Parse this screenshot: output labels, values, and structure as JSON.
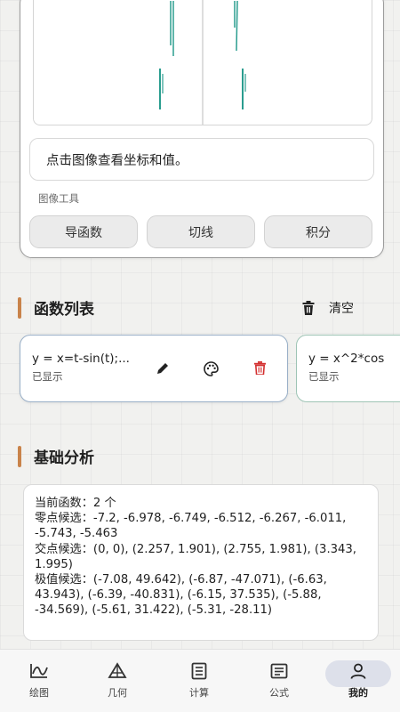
{
  "graph_card": {
    "hint": "点击图像查看坐标和值。",
    "tools_label": "图像工具",
    "tools": [
      "导函数",
      "切线",
      "积分"
    ]
  },
  "function_list": {
    "title": "函数列表",
    "clear_label": "清空",
    "items": [
      {
        "expression": "y = x=t-sin(t);...",
        "status": "已显示"
      },
      {
        "expression": "y = x^2*cos",
        "status": "已显示"
      }
    ]
  },
  "analysis": {
    "title": "基础分析",
    "lines": [
      "当前函数：2 个",
      "零点候选：-7.2, -6.978, -6.749, -6.512, -6.267, -6.011, -5.743, -5.463",
      "交点候选：(0, 0), (2.257, 1.901), (2.755, 1.981), (3.343, 1.995)",
      "极值候选：(-7.08, 49.642), (-6.87, -47.071), (-6.63, 43.943), (-6.39, -40.831), (-6.15, 37.535), (-5.88, -34.569), (-5.61, 31.422), (-5.31, -28.11)"
    ]
  },
  "bottom_nav": {
    "items": [
      {
        "label": "绘图",
        "icon": "plot-icon"
      },
      {
        "label": "几何",
        "icon": "geometry-icon"
      },
      {
        "label": "计算",
        "icon": "calculator-icon"
      },
      {
        "label": "公式",
        "icon": "formula-icon"
      },
      {
        "label": "我的",
        "icon": "profile-icon"
      }
    ],
    "active": "我的"
  },
  "colors": {
    "accent_bar": "#c9834a",
    "curve_teal": "#2a9d8f",
    "delete_red": "#d32f2f",
    "active_nav_bg": "#dde0ea"
  }
}
